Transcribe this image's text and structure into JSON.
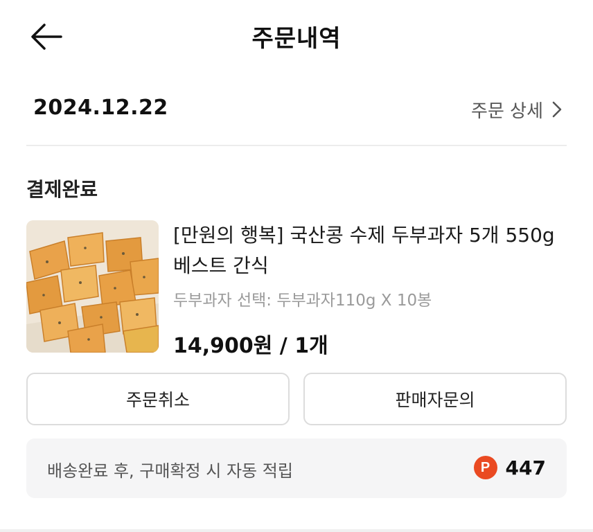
{
  "header": {
    "title": "주문내역",
    "back_icon": "arrow-left-icon"
  },
  "order": {
    "date": "2024.12.22",
    "detail_link": "주문 상세",
    "detail_icon": "chevron-right-icon"
  },
  "status": "결제완료",
  "product": {
    "name": "[만원의 행복] 국산콩 수제 두부과자 5개 550g 베스트 간식",
    "option": "두부과자 선택: 두부과자110g X 10봉",
    "price": "14,900원 / 1개",
    "image": "tofu-snack-thumbnail"
  },
  "buttons": {
    "cancel": "주문취소",
    "inquiry": "판매자문의"
  },
  "points": {
    "text": "배송완료 후, 구매확정 시 자동 적립",
    "icon_letter": "P",
    "value": "447",
    "icon_color": "#ea4a22"
  }
}
